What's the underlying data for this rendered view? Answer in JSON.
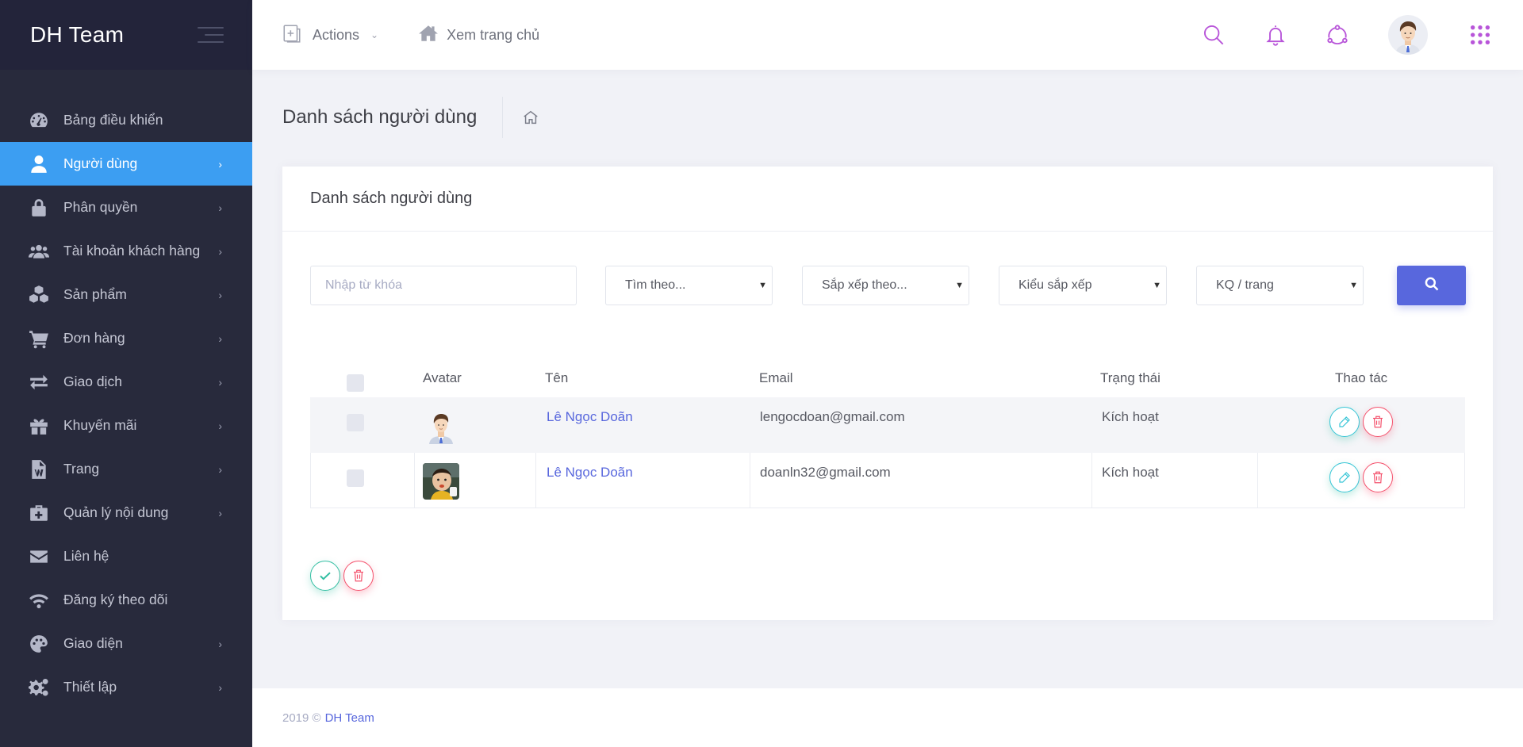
{
  "brand": {
    "title": "DH Team"
  },
  "sidebar": {
    "items": [
      {
        "label": "Bảng điều khiển",
        "icon": "dashboard-icon",
        "active": false,
        "has_arrow": false
      },
      {
        "label": "Người dùng",
        "icon": "user-icon",
        "active": true,
        "has_arrow": true
      },
      {
        "label": "Phân quyền",
        "icon": "lock-icon",
        "active": false,
        "has_arrow": true
      },
      {
        "label": "Tài khoản khách hàng",
        "icon": "users-icon",
        "active": false,
        "has_arrow": true
      },
      {
        "label": "Sản phẩm",
        "icon": "cubes-icon",
        "active": false,
        "has_arrow": true
      },
      {
        "label": "Đơn hàng",
        "icon": "cart-icon",
        "active": false,
        "has_arrow": true
      },
      {
        "label": "Giao dịch",
        "icon": "exchange-icon",
        "active": false,
        "has_arrow": true
      },
      {
        "label": "Khuyến mãi",
        "icon": "gift-icon",
        "active": false,
        "has_arrow": true
      },
      {
        "label": "Trang",
        "icon": "word-file-icon",
        "active": false,
        "has_arrow": true
      },
      {
        "label": "Quản lý nội dung",
        "icon": "medkit-icon",
        "active": false,
        "has_arrow": true
      },
      {
        "label": "Liên hệ",
        "icon": "envelope-icon",
        "active": false,
        "has_arrow": false
      },
      {
        "label": "Đăng ký theo dõi",
        "icon": "wifi-icon",
        "active": false,
        "has_arrow": false
      },
      {
        "label": "Giao diện",
        "icon": "palette-icon",
        "active": false,
        "has_arrow": true
      },
      {
        "label": "Thiết lập",
        "icon": "gears-icon",
        "active": false,
        "has_arrow": true
      }
    ]
  },
  "topbar": {
    "actions_label": "Actions",
    "home_label": "Xem trang chủ",
    "icon_color": "#b855d9"
  },
  "subheader": {
    "title": "Danh sách người dùng"
  },
  "portlet": {
    "title": "Danh sách người dùng",
    "filters": {
      "keyword_placeholder": "Nhập từ khóa",
      "search_by": "Tìm theo...",
      "sort_by": "Sắp xếp theo...",
      "sort_type": "Kiểu sắp xếp",
      "per_page": "KQ / trang"
    },
    "table": {
      "headers": {
        "avatar": "Avatar",
        "name": "Tên",
        "email": "Email",
        "status": "Trạng thái",
        "actions": "Thao tác"
      },
      "rows": [
        {
          "name": "Lê Ngọc Doãn",
          "email": "lengocdoan@gmail.com",
          "status": "Kích hoạt",
          "avatar": "cartoon-man-avatar"
        },
        {
          "name": "Lê Ngọc Doãn",
          "email": "doanln32@gmail.com",
          "status": "Kích hoạt",
          "avatar": "baby-photo-avatar"
        }
      ]
    }
  },
  "footer": {
    "year": "2019 ©",
    "link": "DH Team"
  },
  "colors": {
    "sidebar_bg": "#282a3c",
    "active_item": "#3c9ef2",
    "primary": "#5867dd",
    "success": "#34bfa3",
    "danger": "#f4516c",
    "info": "#36c5d6"
  }
}
